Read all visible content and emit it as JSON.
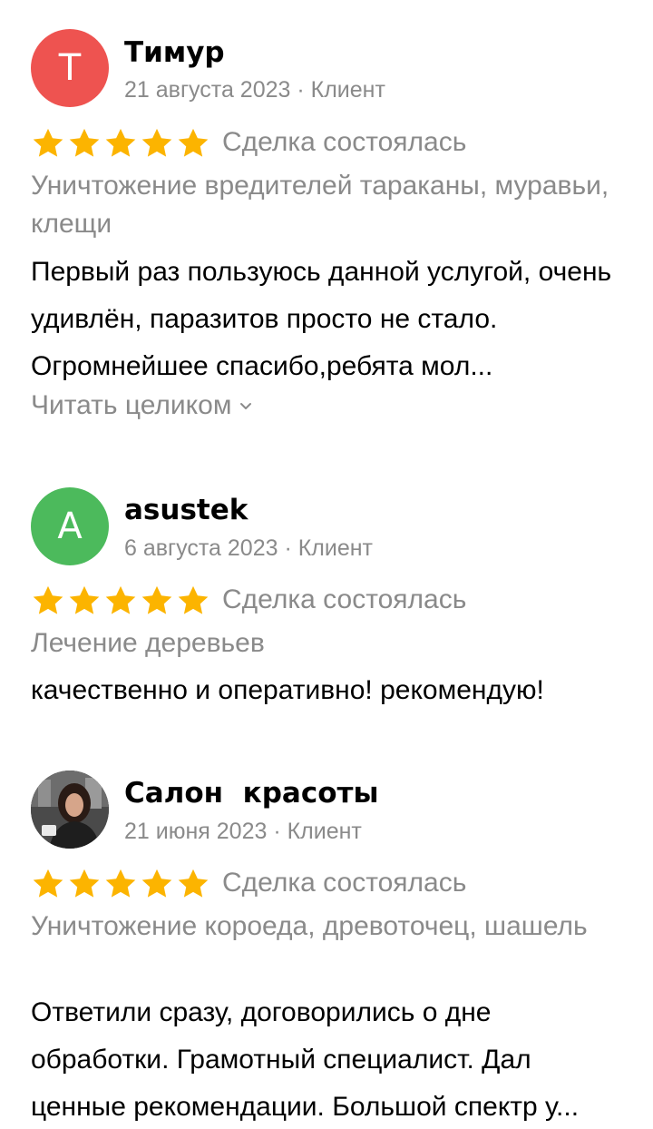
{
  "reviews": [
    {
      "avatar_letter": "Т",
      "avatar_color": "#ee5350",
      "name": "Тимур",
      "meta": "21 августа 2023 · Клиент",
      "rating": 5,
      "deal": "Сделка состоялась",
      "service": "Уничтожение вредителей тараканы, муравьи, клещи",
      "text": "Первый раз пользуюсь данной услугой, очень удивлён, паразитов просто не стало. Огромнейшее спасибо,ребята мол...",
      "read_more": "Читать целиком"
    },
    {
      "avatar_letter": "A",
      "avatar_color": "#4cba5c",
      "name": "asustek",
      "meta": "6 августа 2023 · Клиент",
      "rating": 5,
      "deal": "Сделка состоялась",
      "service": "Лечение деревьев",
      "text": "качественно и оперативно! рекомендую!"
    },
    {
      "name": "Салон  красоты",
      "meta": "21 июня 2023 · Клиент",
      "rating": 5,
      "deal": "Сделка состоялась",
      "service": "Уничтожение короеда, древоточец, шашель",
      "text": "Ответили сразу, договорились о дне обработки.  Грамотный специалист. Дал ценные рекомендации. Большой спектр у..."
    }
  ],
  "colors": {
    "star": "#fcb400",
    "gray_text": "#8a8a8a"
  }
}
